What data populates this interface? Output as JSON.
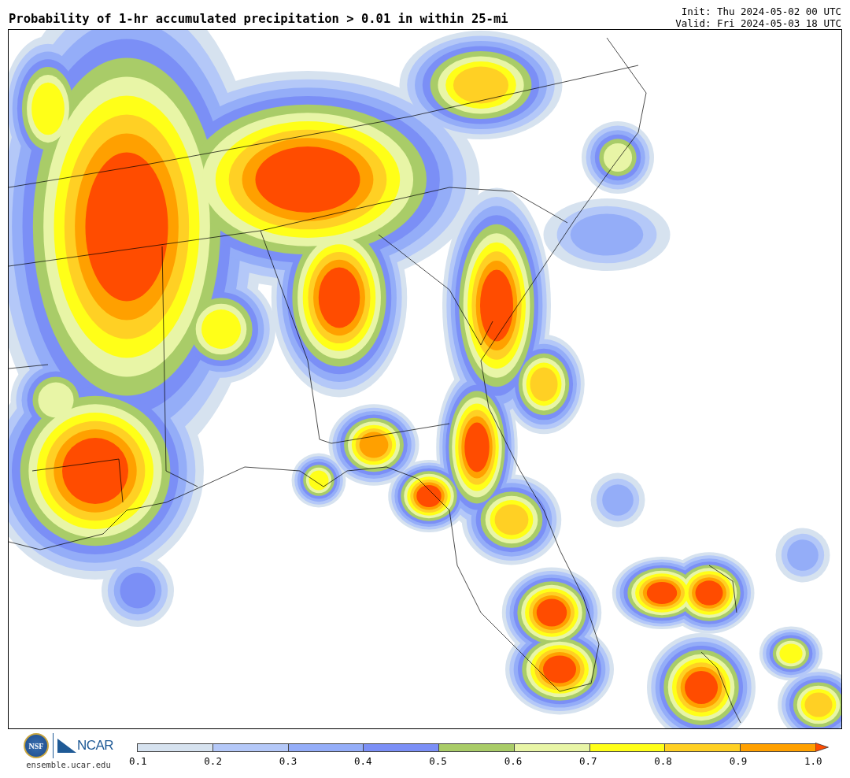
{
  "title": "Probability of 1-hr accumulated precipitation > 0.01 in within 25-mi",
  "init": "Init: Thu 2024-05-02 00 UTC",
  "valid": "Valid: Fri 2024-05-03 18 UTC",
  "logos": {
    "nsf": "NSF",
    "ncar": "NCAR",
    "url": "ensemble.ucar.edu"
  },
  "colorbar": {
    "segments": [
      {
        "color": "#d6e2ef"
      },
      {
        "color": "#b4c8f8"
      },
      {
        "color": "#94adf8"
      },
      {
        "color": "#7b8ff6"
      },
      {
        "color": "#a9cc68"
      },
      {
        "color": "#e8f5a6"
      },
      {
        "color": "#ffff18"
      },
      {
        "color": "#ffd024"
      },
      {
        "color": "#ffa000"
      }
    ],
    "extend": {
      "color": "#ff4c00"
    },
    "ticks": [
      "0.1",
      "0.2",
      "0.3",
      "0.4",
      "0.5",
      "0.6",
      "0.7",
      "0.8",
      "0.9",
      "1.0"
    ]
  }
}
